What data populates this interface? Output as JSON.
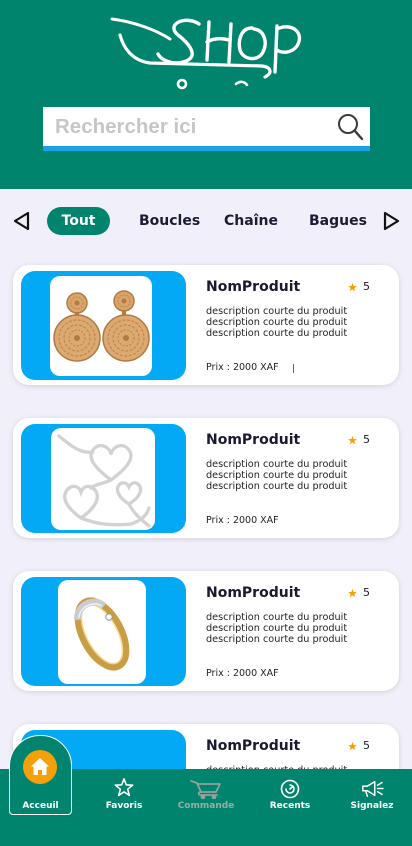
{
  "header": {
    "logo_text": "SHOP",
    "logo_icon": "shop-cart-logo"
  },
  "search": {
    "placeholder": "Rechercher ici",
    "icon": "search-icon"
  },
  "categories": {
    "prev_icon": "triangle-left-icon",
    "next_icon": "triangle-right-icon",
    "items": [
      {
        "label": "Tout",
        "active": true
      },
      {
        "label": "Boucles",
        "active": false
      },
      {
        "label": "Chaîne",
        "active": false
      },
      {
        "label": "Bagues",
        "active": false
      }
    ]
  },
  "products": [
    {
      "name": "NomProduit",
      "rating": "5",
      "rating_icon": "star-icon",
      "description": [
        "description courte du produit",
        "description courte du produit",
        "description courte du produit"
      ],
      "price": "Prix : 2000 XAF"
    },
    {
      "name": "NomProduit",
      "rating": "5",
      "rating_icon": "star-icon",
      "description": [
        "description courte du produit",
        "description courte du produit",
        "description courte du produit"
      ],
      "price": "Prix : 2000 XAF"
    },
    {
      "name": "NomProduit",
      "rating": "5",
      "rating_icon": "star-icon",
      "description": [
        "description courte du produit",
        "description courte du produit",
        "description courte du produit"
      ],
      "price": "Prix : 2000 XAF"
    },
    {
      "name": "NomProduit",
      "rating": "5",
      "rating_icon": "star-icon",
      "description": [
        "description courte du produit"
      ]
    }
  ],
  "bottom_nav": {
    "items": [
      {
        "label": "Acceuil",
        "icon": "home-icon",
        "active": true
      },
      {
        "label": "Favoris",
        "icon": "star-outline-icon",
        "active": false
      },
      {
        "label": "Commande",
        "icon": "cart-icon",
        "active": false,
        "muted": true
      },
      {
        "label": "Recents",
        "icon": "clock-icon",
        "active": false
      },
      {
        "label": "Signalez",
        "icon": "megaphone-icon",
        "active": false
      }
    ]
  },
  "colors": {
    "primary": "#00846e",
    "accent": "#f5a00a",
    "image_background": "#03a9f4",
    "search_underline": "#1aa0e6",
    "page_background": "#f1f0fa",
    "text_dark": "#1c1c30",
    "nav_muted": "#98aea8"
  }
}
